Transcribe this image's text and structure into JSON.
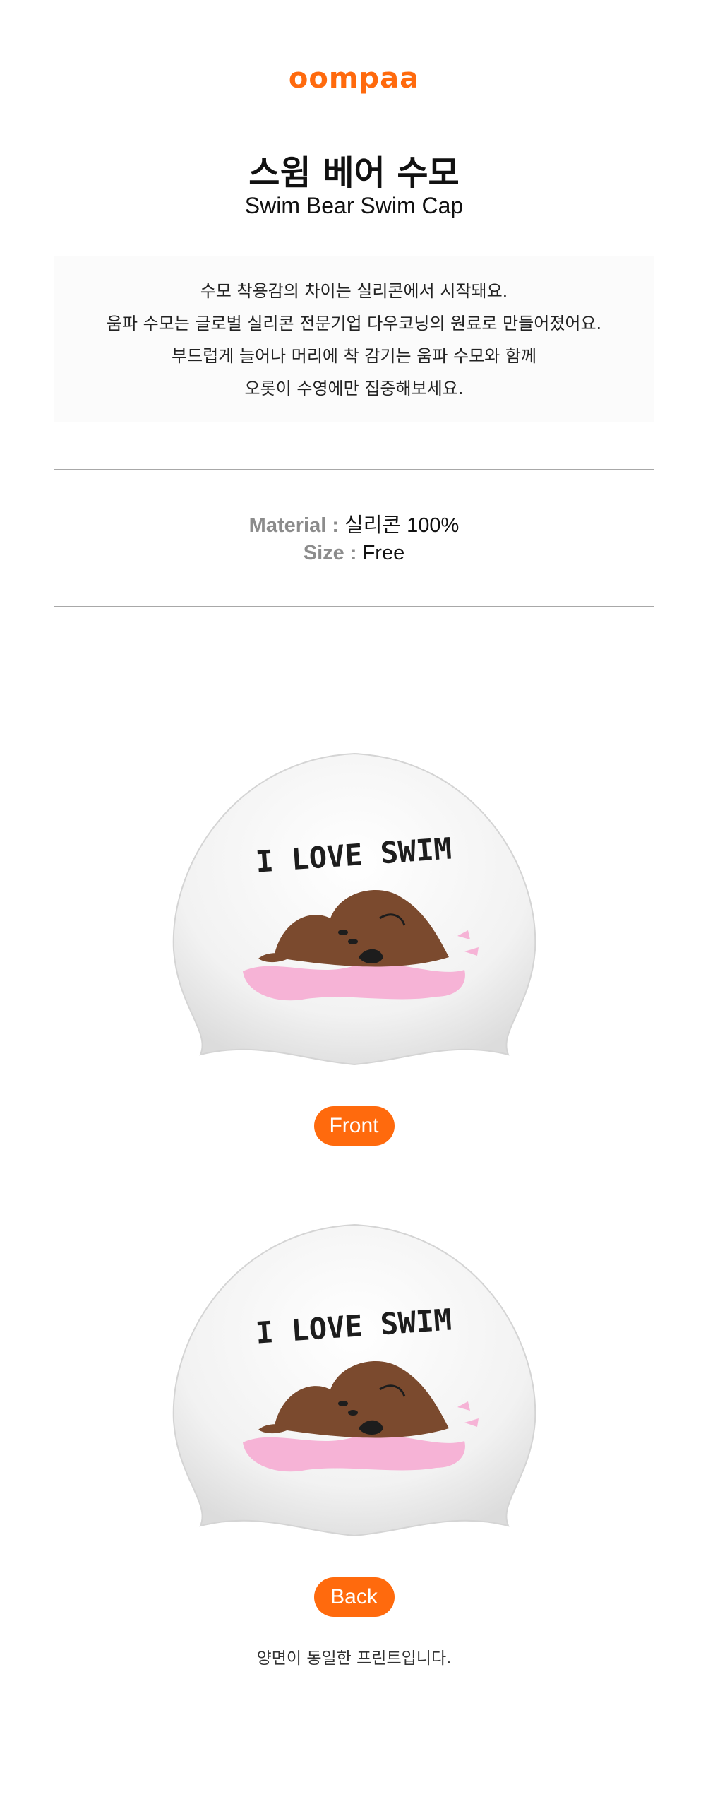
{
  "brand": {
    "name": "oompaa",
    "color": "#ff6a0d"
  },
  "product": {
    "title_ko": "스윔 베어  수모",
    "title_en": "Swim Bear Swim Cap"
  },
  "description": [
    "수모 착용감의 차이는 실리콘에서 시작돼요.",
    "움파 수모는 글로벌 실리콘 전문기업 다우코닝의 원료로 만들어졌어요.",
    "부드럽게 늘어나 머리에 착 감기는 움파 수모와 함께",
    "오롯이 수영에만 집중해보세요."
  ],
  "specs": {
    "material_label": "Material :",
    "material_value": "실리콘 100%",
    "size_label": "Size :",
    "size_value": "Free"
  },
  "views": {
    "front_label": "Front",
    "back_label": "Back",
    "cap_print_text": "I LOVE SWIM"
  },
  "footer_note": "양면이 동일한 프린트입니다.",
  "colors": {
    "accent": "#ff6a0d",
    "bear": "#7b4a2e",
    "pillow": "#f6b3d6",
    "cap": "#f3f3f3"
  }
}
